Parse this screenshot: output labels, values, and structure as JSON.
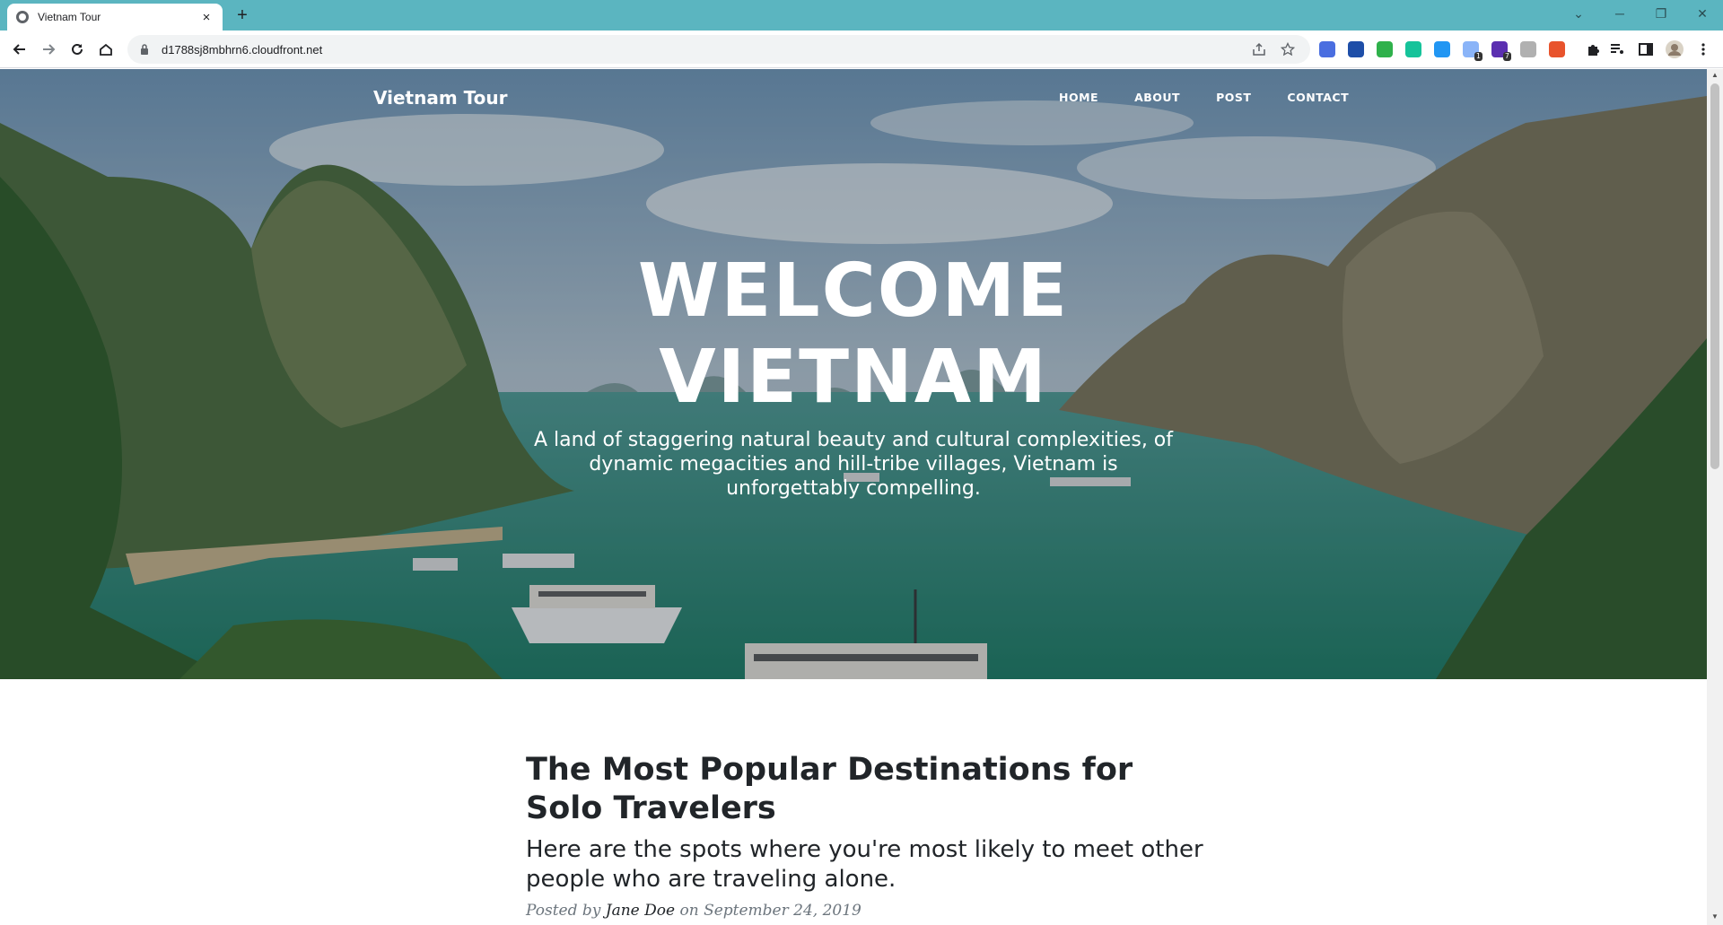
{
  "browser": {
    "tab_title": "Vietnam Tour",
    "tab_close": "×",
    "new_tab": "+",
    "url": "d1788sj8mbhrn6.cloudfront.net",
    "window_controls": {
      "dropdown": "⌄",
      "minimize": "─",
      "restore": "❐",
      "close": "✕"
    },
    "extensions": [
      {
        "name": "translate-extension-icon",
        "color": "#4a6ee0"
      },
      {
        "name": "j-extension-icon",
        "color": "#1e4ea8"
      },
      {
        "name": "shield-extension-icon",
        "color": "#2fb14b"
      },
      {
        "name": "grammarly-extension-icon",
        "color": "#15c39a"
      },
      {
        "name": "download-extension-icon",
        "color": "#2196f3"
      },
      {
        "name": "extension-badge-1-icon",
        "color": "#8ab4f8",
        "badge": "1"
      },
      {
        "name": "extension-badge-7-icon",
        "color": "#5b2fb0",
        "badge": "7"
      },
      {
        "name": "gray-extension-icon",
        "color": "#b0b0b0"
      },
      {
        "name": "fire-extension-icon",
        "color": "#e8532c"
      }
    ]
  },
  "site": {
    "brand": "Vietnam Tour",
    "nav": [
      {
        "label": "HOME"
      },
      {
        "label": "ABOUT"
      },
      {
        "label": "POST"
      },
      {
        "label": "CONTACT"
      }
    ],
    "hero": {
      "title_line1": "WELCOME",
      "title_line2": "VIETNAM",
      "subtitle": "A land of staggering natural beauty and cultural complexities, of dynamic megacities and hill-tribe villages, Vietnam is unforgettably compelling."
    },
    "post": {
      "title": "The Most Popular Destinations for Solo Travelers",
      "subtitle": "Here are the spots where you're most likely to meet other people who are traveling alone.",
      "meta_prefix": "Posted by",
      "author": "Jane Doe",
      "meta_on": "on September 24, 2019"
    }
  },
  "colors": {
    "tabbar": "#5bb5c0",
    "text_dark": "#212529",
    "meta_gray": "#6c757d"
  }
}
